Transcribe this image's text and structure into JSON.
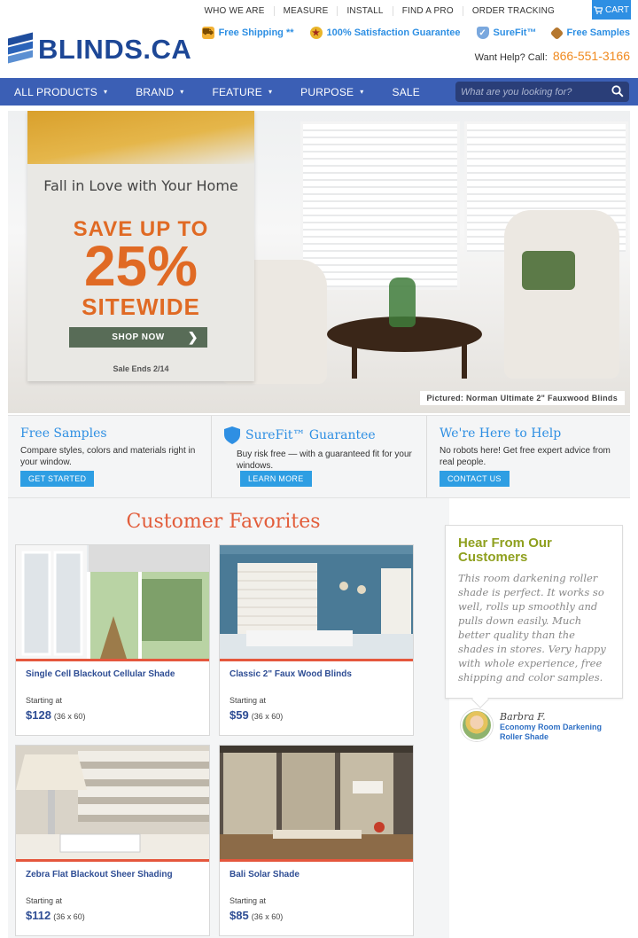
{
  "header": {
    "top_links": [
      "WHO WE ARE",
      "MEASURE",
      "INSTALL",
      "FIND A PRO",
      "ORDER TRACKING"
    ],
    "cart_label": "CART",
    "logo_text": "BLINDS.CA",
    "promos": [
      {
        "label": "Free Shipping **",
        "icon": "truck-badge-icon"
      },
      {
        "label": "100% Satisfaction Guarantee",
        "icon": "guarantee-badge-icon"
      },
      {
        "label": "SureFit™",
        "icon": "surefit-shield-icon"
      },
      {
        "label": "Free Samples",
        "icon": "swatch-icon"
      }
    ],
    "help_text": "Want Help? Call:",
    "phone": "866-551-3166"
  },
  "nav": {
    "items": [
      {
        "label": "ALL PRODUCTS",
        "dropdown": true
      },
      {
        "label": "BRAND",
        "dropdown": true
      },
      {
        "label": "FEATURE",
        "dropdown": true
      },
      {
        "label": "PURPOSE",
        "dropdown": true
      },
      {
        "label": "SALE",
        "dropdown": false
      }
    ],
    "search_placeholder": "What are you looking for?"
  },
  "hero": {
    "tagline": "Fall in Love with Your Home",
    "save_line": "SAVE UP TO",
    "percent": "25%",
    "sitewide": "SITEWIDE",
    "cta": "SHOP NOW",
    "ends": "Sale Ends 2/14",
    "pictured": "Pictured: Norman Ultimate 2\" Fauxwood Blinds"
  },
  "info": [
    {
      "title": "Free Samples",
      "text": "Compare styles, colors and materials right in your window.",
      "button": "GET STARTED"
    },
    {
      "title": "SureFit™ Guarantee",
      "text": "Buy risk free — with a guaranteed fit for your windows.",
      "button": "LEARN MORE"
    },
    {
      "title": "We're Here to Help",
      "text": "No robots here! Get free expert advice from real people.",
      "button": "CONTACT US"
    }
  ],
  "favorites": {
    "title": "Customer Favorites",
    "products": [
      {
        "name": "Single Cell Blackout Cellular Shade",
        "from": "Starting at",
        "price": "$128",
        "size": "(36 x 60)"
      },
      {
        "name": "Classic 2\" Faux Wood Blinds",
        "from": "Starting at",
        "price": "$59",
        "size": "(36 x 60)"
      },
      {
        "name": "Zebra Flat Blackout Sheer Shading",
        "from": "Starting at",
        "price": "$112",
        "size": "(36 x 60)"
      },
      {
        "name": "Bali Solar Shade",
        "from": "Starting at",
        "price": "$85",
        "size": "(36 x 60)"
      }
    ]
  },
  "testimonial": {
    "heading": "Hear From Our Customers",
    "quote": "This room darkening roller shade is perfect. It works so well, rolls up smoothly and pulls down easily. Much better quality than the shades in stores. Very happy with whole experience, free shipping and color samples.",
    "name": "Barbra F.",
    "product": "Economy Room Darkening Roller Shade"
  },
  "colors": {
    "nav_blue": "#3b5fb5",
    "link_blue": "#2e8fe3",
    "accent_orange": "#e06a24",
    "title_red": "#e25d3b",
    "testimonial_green": "#8fa01f"
  }
}
